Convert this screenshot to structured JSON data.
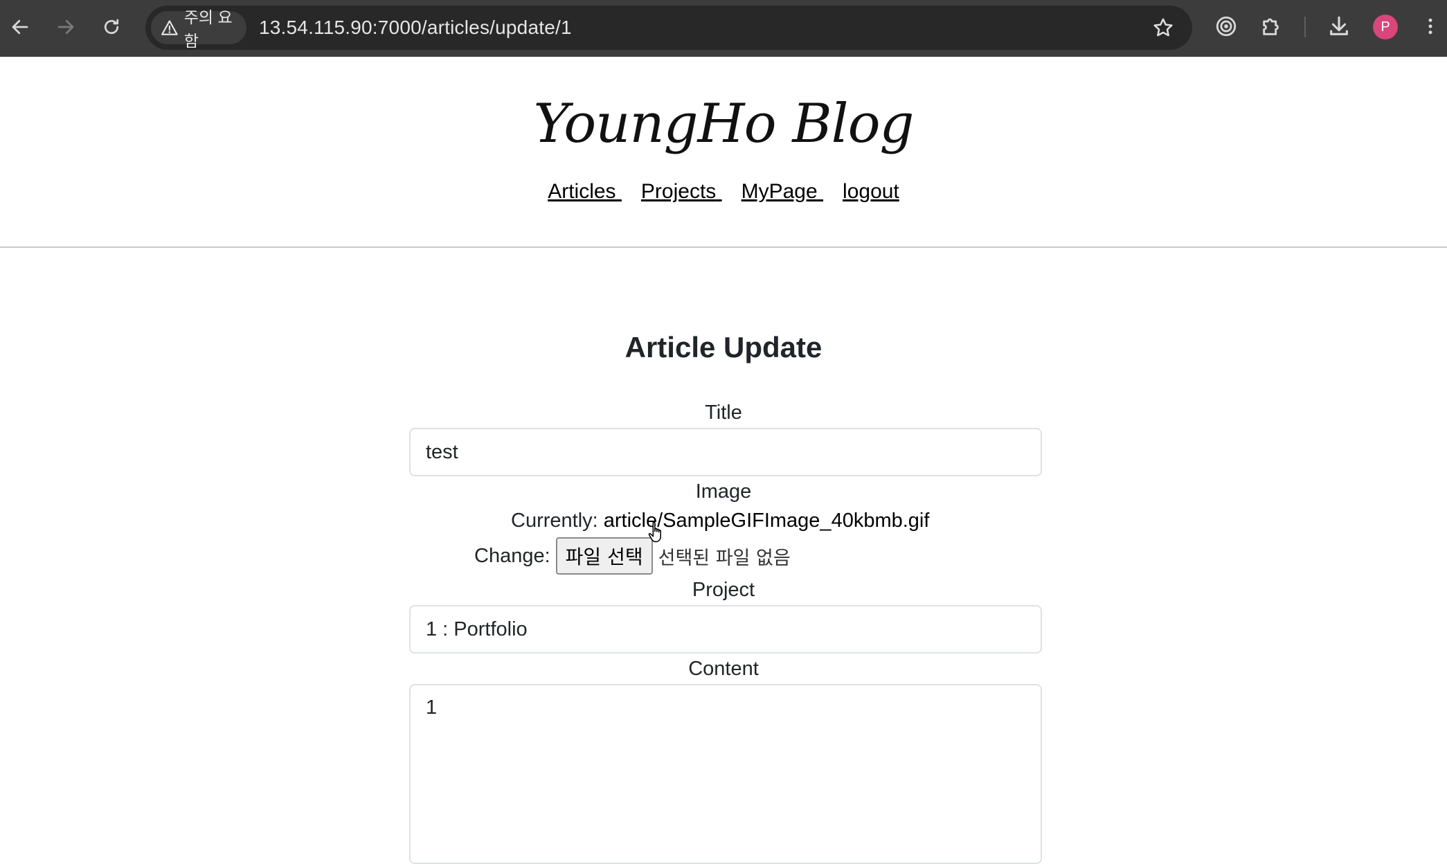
{
  "browser": {
    "security_chip_label": "주의 요함",
    "url": "13.54.115.90:7000/articles/update/1",
    "avatar_initial": "P"
  },
  "site": {
    "brand": "YoungHo Blog",
    "nav": [
      "Articles",
      "Projects",
      "MyPage",
      "logout"
    ]
  },
  "form": {
    "heading": "Article Update",
    "title_label": "Title",
    "title_value": "test",
    "image_label": "Image",
    "currently_label": "Currently:",
    "currently_file": "article/SampleGIFImage_40kbmb.gif",
    "change_label": "Change:",
    "choose_file_button": "파일 선택",
    "no_file_text": "선택된 파일 없음",
    "project_label": "Project",
    "project_value": "1 : Portfolio",
    "content_label": "Content",
    "content_value": "1"
  },
  "colors": {
    "chrome_bg": "#3c3c3c",
    "omnibox_bg": "#282828",
    "avatar_bg": "#d8467a"
  }
}
